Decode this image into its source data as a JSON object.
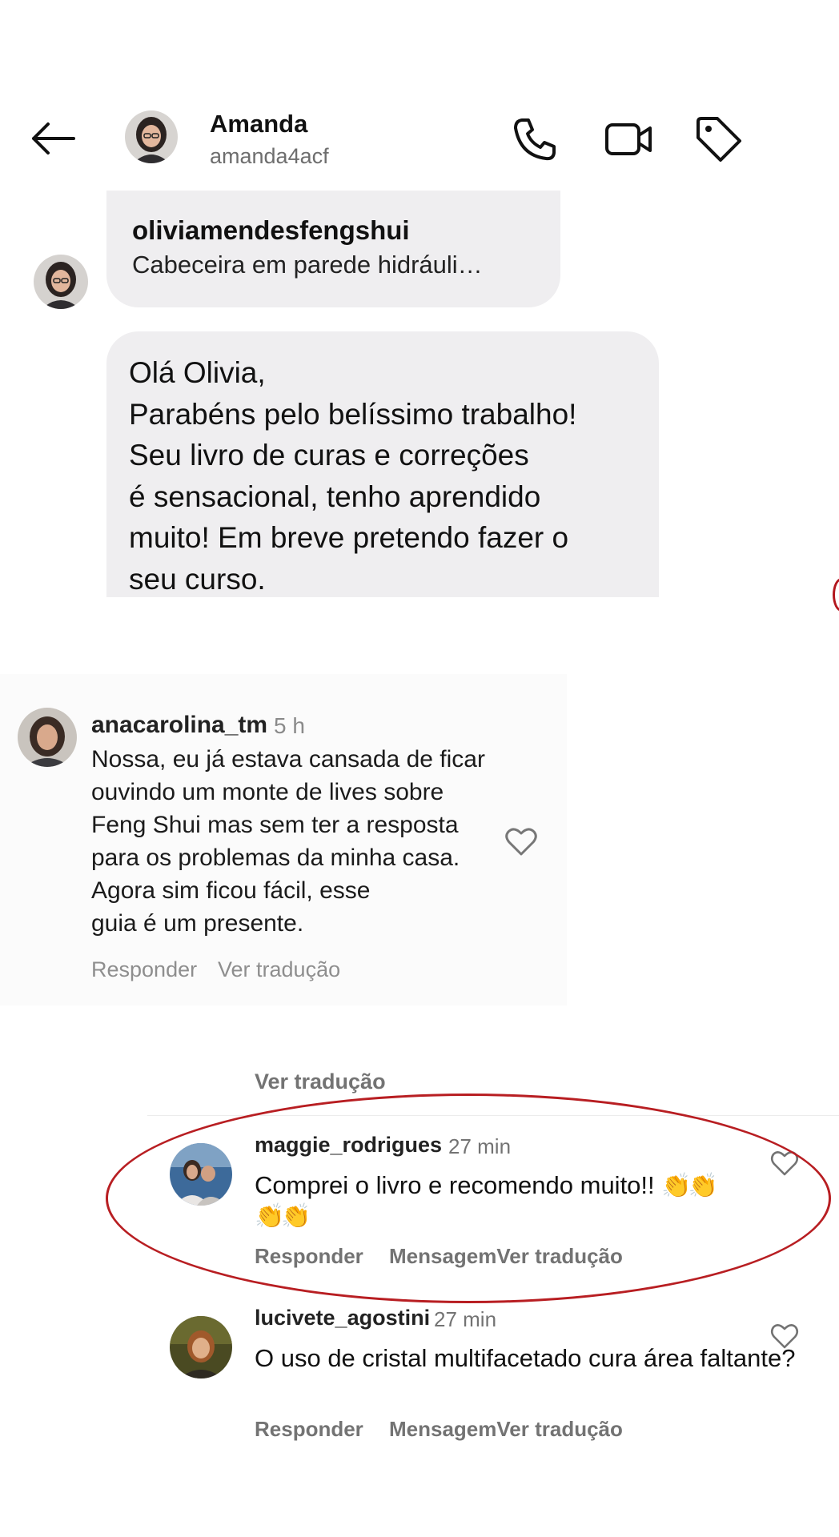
{
  "header": {
    "name": "Amanda",
    "username": "amanda4acf",
    "icons": [
      "back-arrow-icon",
      "phone-icon",
      "video-camera-icon",
      "tag-icon"
    ]
  },
  "chat": {
    "shared_post": {
      "account": "oliviamendesfengshui",
      "caption": "Cabeceira em parede hidráuli…"
    },
    "message": "Olá Olivia,\nParabéns pelo belíssimo trabalho!\nSeu livro de curas e correções\né sensacional, tenho aprendido\nmuito! Em breve pretendo fazer o\nseu curso."
  },
  "comment_screenshot": {
    "username": "anacarolina_tm",
    "time": "5 h",
    "text": "Nossa, eu já estava cansada de ficar\nouvindo um monte de lives sobre\nFeng Shui mas sem ter a resposta\npara os problemas da minha casa.\nAgora sim ficou fácil, esse\nguia é um presente.",
    "reply_label": "Responder",
    "translate_label": "Ver tradução"
  },
  "comments": {
    "top_translate_label": "Ver tradução",
    "items": [
      {
        "username": "maggie_rodrigues",
        "time": "27 min",
        "text": "Comprei o livro e recomendo muito!!",
        "emoji": "👏👏",
        "emoji2": "👏👏",
        "reply_label": "Responder",
        "actions_label": "MensagemVer tradução"
      },
      {
        "username": "lucivete_agostini",
        "time": "27 min",
        "text": "O uso de cristal multifacetado cura área faltante?",
        "reply_label": "Responder",
        "actions_label": "MensagemVer tradução"
      }
    ]
  },
  "colors": {
    "bubble": "#efeef0",
    "highlight": "#b81e22",
    "muted": "#737373"
  }
}
